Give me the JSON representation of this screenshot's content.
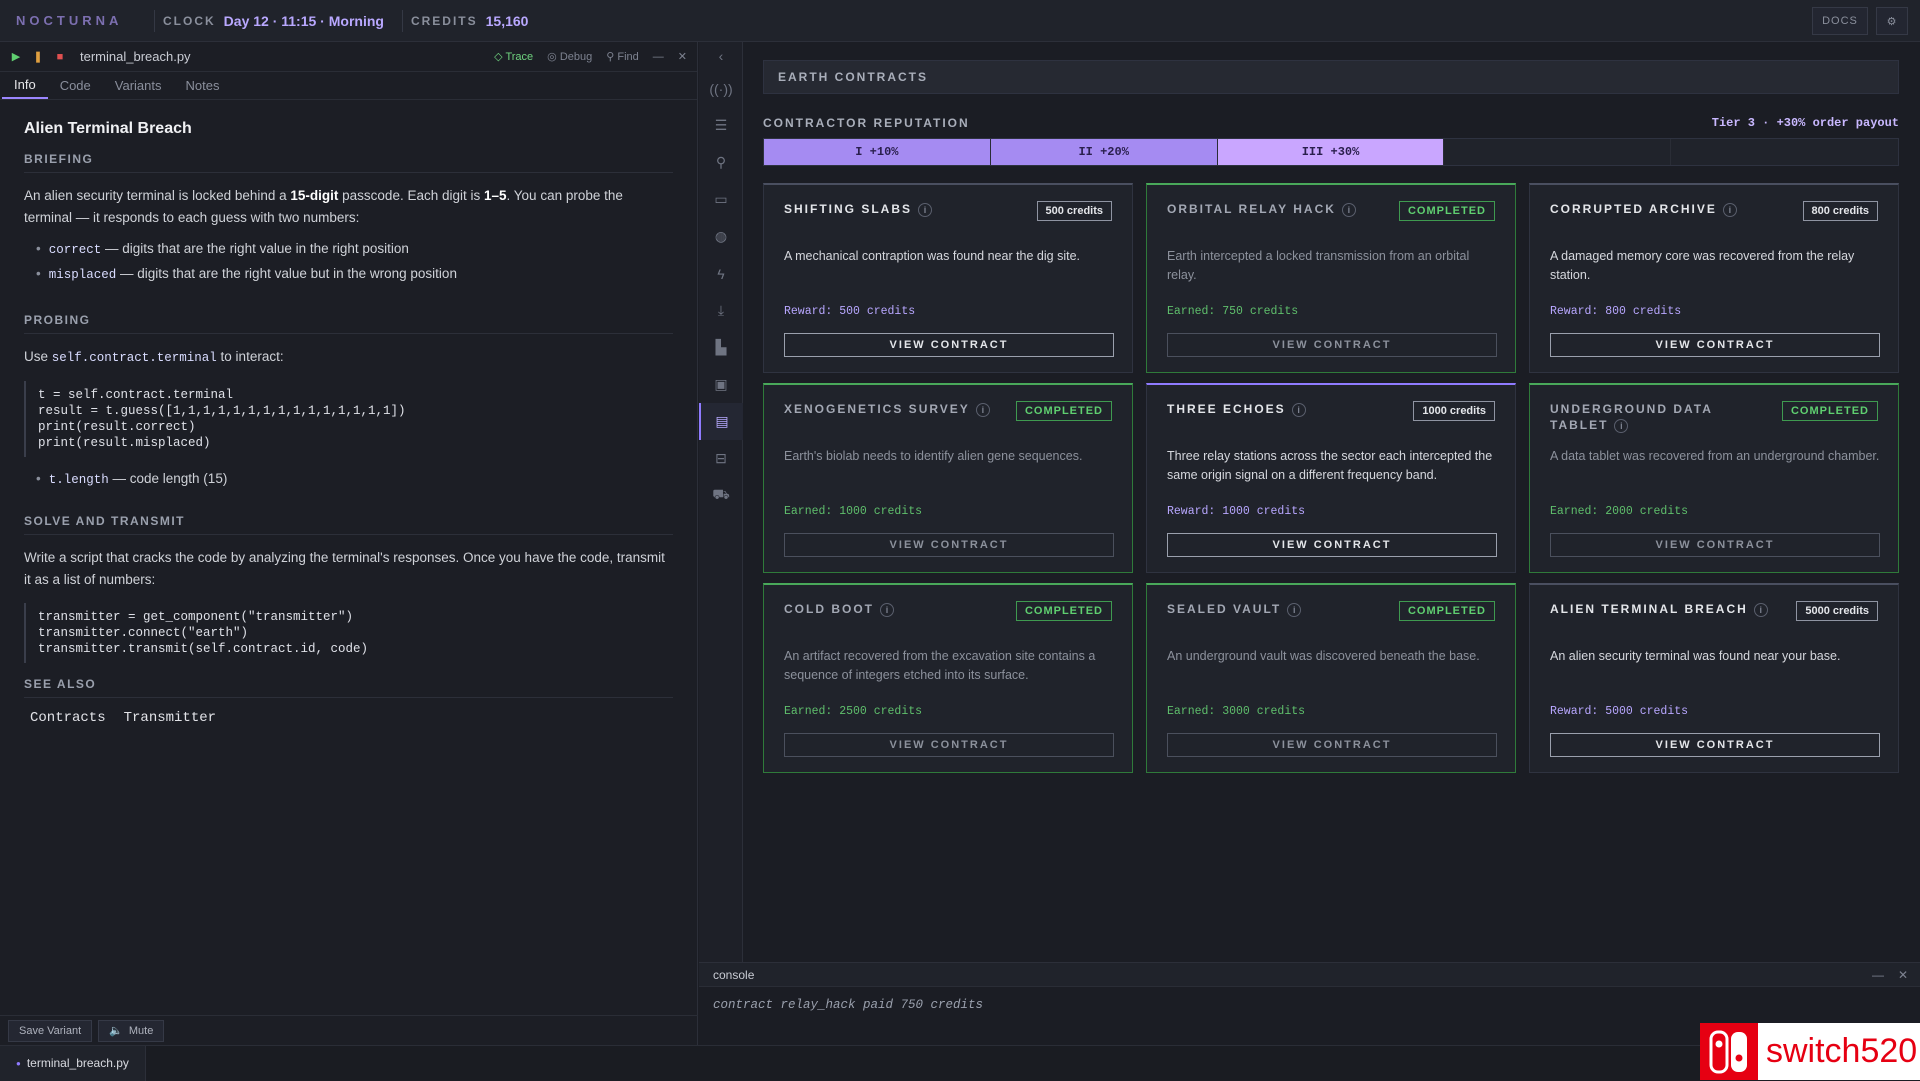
{
  "topbar": {
    "brand": "NOCTURNA",
    "clock_label": "CLOCK",
    "clock_value": "Day 12 · 11:15 · Morning",
    "credits_label": "CREDITS",
    "credits_value": "15,160",
    "docs_label": "DOCS",
    "settings_icon": "gear-icon"
  },
  "editor": {
    "filename": "terminal_breach.py",
    "trace_label": "Trace",
    "debug_label": "Debug",
    "find_label": "Find",
    "tabs": [
      {
        "label": "Info"
      },
      {
        "label": "Code"
      },
      {
        "label": "Variants"
      },
      {
        "label": "Notes"
      }
    ],
    "save_variant_label": "Save Variant",
    "mute_label": "Mute"
  },
  "doc": {
    "title": "Alien Terminal Breach",
    "briefing_heading": "BRIEFING",
    "briefing_1": "An alien security terminal is locked behind a ",
    "briefing_bold1": "15-digit",
    "briefing_2": " passcode. Each digit is ",
    "briefing_bold2": "1–5",
    "briefing_3": ". You can probe the terminal — it responds to each guess with two numbers:",
    "bullet1_code": "correct",
    "bullet1_text": " — digits that are the right value in the right position",
    "bullet2_code": "misplaced",
    "bullet2_text": " — digits that are the right value but in the wrong position",
    "probing_heading": "PROBING",
    "probing_pre": "Use ",
    "probing_code": "self.contract.terminal",
    "probing_post": " to interact:",
    "code1": "t = self.contract.terminal\nresult = t.guess([1,1,1,1,1,1,1,1,1,1,1,1,1,1,1])\nprint(result.correct)\nprint(result.misplaced)",
    "bullet3_code": "t.length",
    "bullet3_text": " — code length (15)",
    "solve_heading": "SOLVE AND TRANSMIT",
    "solve_text": "Write a script that cracks the code by analyzing the terminal's responses. Once you have the code, transmit it as a list of numbers:",
    "code2": "transmitter = get_component(\"transmitter\")\ntransmitter.connect(\"earth\")\ntransmitter.transmit(self.contract.id, code)",
    "seealso_heading": "SEE ALSO",
    "seealso_links": [
      "Contracts",
      "Transmitter"
    ]
  },
  "statusbar": {
    "file_tab": "terminal_breach.py"
  },
  "rail": {
    "icons": [
      "broadcast-icon",
      "layers-icon",
      "search-icon",
      "monitor-icon",
      "globe-icon",
      "bolt-icon",
      "download-icon",
      "factory-icon",
      "briefcase-icon",
      "contracts-icon",
      "toolbox-icon",
      "cart-icon"
    ],
    "active_index": 9
  },
  "contracts": {
    "header": "EARTH CONTRACTS",
    "reputation_label": "CONTRACTOR REPUTATION",
    "tier_text": "Tier 3 · +30% order payout",
    "reputation_segments": [
      {
        "label": "I +10%",
        "state": "filled"
      },
      {
        "label": "II +20%",
        "state": "filled"
      },
      {
        "label": "III +30%",
        "state": "current"
      },
      {
        "label": "",
        "state": "empty"
      },
      {
        "label": "",
        "state": "empty"
      }
    ],
    "cards": [
      {
        "title": "SHIFTING SLABS",
        "badge": "500 credits",
        "desc": "A mechanical contraption was found near the dig site.",
        "reward": "Reward: 500 credits",
        "button": "VIEW CONTRACT",
        "completed": false
      },
      {
        "title": "ORBITAL RELAY HACK",
        "badge": "COMPLETED",
        "desc": "Earth intercepted a locked transmission from an orbital relay.",
        "reward": "Earned: 750 credits",
        "button": "VIEW CONTRACT",
        "completed": true
      },
      {
        "title": "CORRUPTED ARCHIVE",
        "badge": "800 credits",
        "desc": "A damaged memory core was recovered from the relay station.",
        "reward": "Reward: 800 credits",
        "button": "VIEW CONTRACT",
        "completed": false
      },
      {
        "title": "XENOGENETICS SURVEY",
        "badge": "COMPLETED",
        "desc": "Earth's biolab needs to identify alien gene sequences.",
        "reward": "Earned: 1000 credits",
        "button": "VIEW CONTRACT",
        "completed": true
      },
      {
        "title": "THREE ECHOES",
        "badge": "1000 credits",
        "desc": "Three relay stations across the sector each intercepted the same origin signal on a different frequency band.",
        "reward": "Reward: 1000 credits",
        "button": "VIEW CONTRACT",
        "completed": false
      },
      {
        "title": "UNDERGROUND DATA TABLET",
        "badge": "COMPLETED",
        "desc": "A data tablet was recovered from an underground chamber.",
        "reward": "Earned: 2000 credits",
        "button": "VIEW CONTRACT",
        "completed": true
      },
      {
        "title": "COLD BOOT",
        "badge": "COMPLETED",
        "desc": "An artifact recovered from the excavation site contains a sequence of integers etched into its surface.",
        "reward": "Earned: 2500 credits",
        "button": "VIEW CONTRACT",
        "completed": true
      },
      {
        "title": "SEALED VAULT",
        "badge": "COMPLETED",
        "desc": "An underground vault was discovered beneath the base.",
        "reward": "Earned: 3000 credits",
        "button": "VIEW CONTRACT",
        "completed": true
      },
      {
        "title": "ALIEN TERMINAL BREACH",
        "badge": "5000 credits",
        "desc": "An alien security terminal was found near your base.",
        "reward": "Reward: 5000 credits",
        "button": "VIEW CONTRACT",
        "completed": false
      }
    ]
  },
  "console": {
    "title": "console",
    "lines": [
      "contract relay_hack paid 750 credits"
    ]
  },
  "watermark": {
    "text": "switch520"
  },
  "colors": {
    "accent": "#9b86ff",
    "completed": "#49a85a",
    "background": "#1b1d24"
  }
}
